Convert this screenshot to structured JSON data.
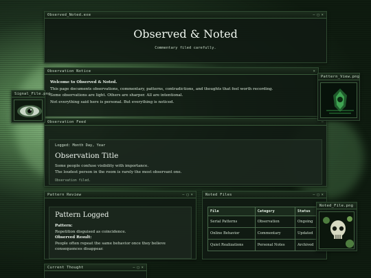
{
  "windows": {
    "header": {
      "title": "Observed_Noted.exe",
      "heading": "Observed & Noted",
      "tagline": "Commentary filed carefully."
    },
    "notice": {
      "title": "Observation Notice",
      "welcome": "Welcome to Observed & Noted.",
      "lines": [
        "This page documents observations, commentary, patterns, contradictions, and thoughts that feel worth recording.",
        "Some observations are light. Others are sharper. All are intentional.",
        "Not everything said here is personal. But everything is noticed."
      ]
    },
    "feed": {
      "title": "Observation Feed",
      "logged": "Logged: Month Day, Year",
      "post_title": "Observation Title",
      "lines": [
        "Some people confuse visibility with importance.",
        "The loudest person in the room is rarely the most observant one."
      ],
      "footer": "Observation filed."
    },
    "pattern": {
      "title": "Pattern Review",
      "heading": "Pattern Logged",
      "pattern_label": "Pattern:",
      "pattern_text": "Repetition disguised as coincidence.",
      "result_label": "Observed Result:",
      "result_text": "People often repeat the same behavior once they believe consequences disappear."
    },
    "files": {
      "title": "Noted Files",
      "headers": [
        "File",
        "Category",
        "Status"
      ],
      "rows": [
        [
          "Serial Patterns",
          "Observation",
          "Ongoing"
        ],
        [
          "Online Behavior",
          "Commentary",
          "Updated"
        ],
        [
          "Quiet Realizations",
          "Personal Notes",
          "Archived"
        ]
      ]
    },
    "current": {
      "title": "Current Thought"
    },
    "signal": {
      "title": "Signal_File.png"
    },
    "pattern_view": {
      "title": "Pattern_View.png"
    },
    "noted_file": {
      "title": "Noted_File.png"
    }
  },
  "controls": {
    "minimize": "–",
    "maximize": "□",
    "close": "×"
  },
  "colors": {
    "accent": "#8fc18c",
    "window_bg": "#101a12",
    "border": "#2f4a31"
  }
}
